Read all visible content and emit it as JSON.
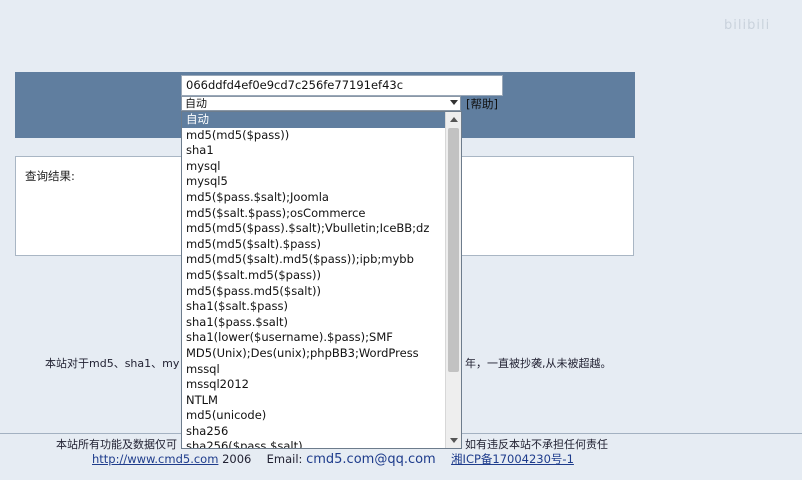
{
  "watermark": "bilibili",
  "query": {
    "hash_value": "066ddfd4ef0e9cd7c256fe77191ef43c",
    "type_selected": "自动",
    "help_label": "[帮助]"
  },
  "result": {
    "label": "查询结果:"
  },
  "dropdown": {
    "options": [
      "自动",
      "md5(md5($pass))",
      "sha1",
      "mysql",
      "mysql5",
      "md5($pass.$salt);Joomla",
      "md5($salt.$pass);osCommerce",
      "md5(md5($pass).$salt);Vbulletin;IceBB;dz",
      "md5(md5($salt).$pass)",
      "md5(md5($salt).md5($pass));ipb;mybb",
      "md5($salt.md5($pass))",
      "md5($pass.md5($salt))",
      "sha1($salt.$pass)",
      "sha1($pass.$salt)",
      "sha1(lower($username).$pass);SMF",
      "MD5(Unix);Des(unix);phpBB3;WordPress",
      "mssql",
      "mssql2012",
      "NTLM",
      "md5(unicode)",
      "sha256",
      "sha256($pass.$salt)"
    ],
    "selected_index": 0
  },
  "about": {
    "left": "本站对于md5、sha1、my",
    "right": "年，一直被抄袭,从未被超越。"
  },
  "footer": {
    "note_left": "本站所有功能及数据仅可",
    "note_right": "如有违反本站不承担任何责任",
    "site_link": "http://www.cmd5.com",
    "year": "2006",
    "email_label": "Email:",
    "email": "cmd5.com@qq.com",
    "icp": "湘ICP备17004230号-1"
  }
}
